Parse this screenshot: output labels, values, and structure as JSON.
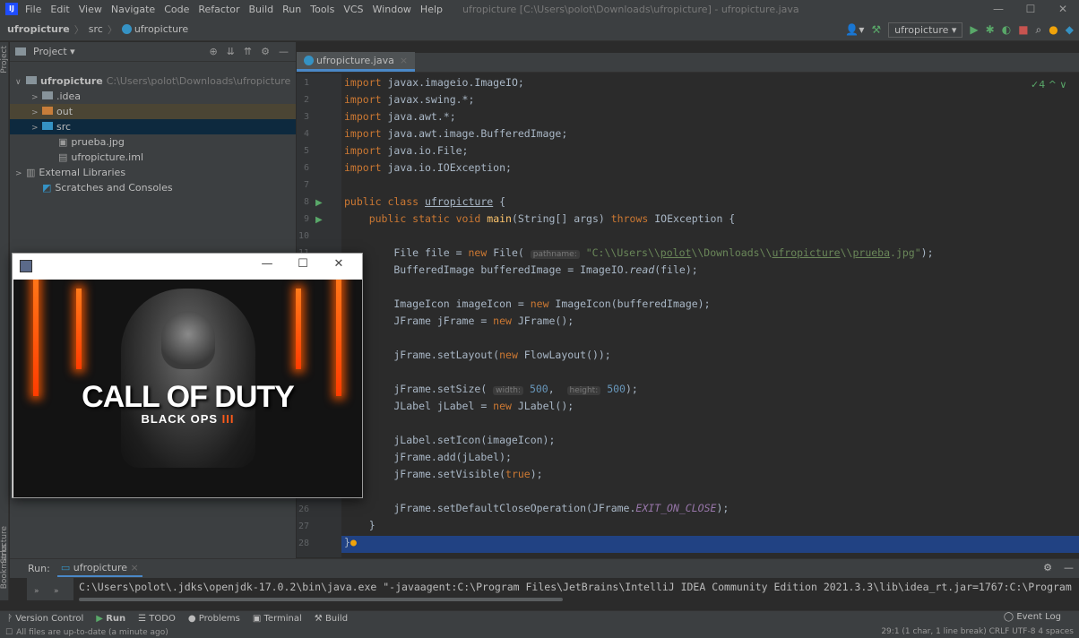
{
  "menubar": {
    "items": [
      "File",
      "Edit",
      "View",
      "Navigate",
      "Code",
      "Refactor",
      "Build",
      "Run",
      "Tools",
      "VCS",
      "Window",
      "Help"
    ],
    "window_title": "ufropicture [C:\\Users\\polot\\Downloads\\ufropicture] - ufropicture.java",
    "logo_text": "IJ",
    "win_min": "—",
    "win_max": "☐",
    "win_close": "✕"
  },
  "navbar": {
    "crumbs": [
      "ufropicture",
      "src",
      "ufropicture"
    ],
    "run_config": "ufropicture ▾"
  },
  "left_stripe": {
    "project": "Project",
    "structure": "Structure",
    "bookmarks": "Bookmarks"
  },
  "project_pane": {
    "title": "Project ▾",
    "tree": [
      {
        "arrow": "∨",
        "label": "ufropicture",
        "path": "C:\\Users\\polot\\Downloads\\ufropicture"
      },
      {
        "arrow": ">",
        "label": ".idea"
      },
      {
        "arrow": ">",
        "label": "out"
      },
      {
        "arrow": ">",
        "label": "src"
      },
      {
        "label": "prueba.jpg"
      },
      {
        "label": "ufropicture.iml"
      },
      {
        "arrow": ">",
        "label": "External Libraries"
      },
      {
        "label": "Scratches and Consoles"
      }
    ]
  },
  "editor": {
    "tab": "ufropicture.java",
    "tab_close": "×",
    "badge": "✓4 ^ ∨",
    "line_numbers": [
      "1",
      "2",
      "3",
      "4",
      "5",
      "6",
      "7",
      "8",
      "9",
      "10",
      "11",
      "26",
      "27",
      "28"
    ],
    "hints": {
      "pathname": "pathname:",
      "width": "width:",
      "height": "height:"
    }
  },
  "java_window": {
    "title_buttons": [
      "—",
      "☐",
      "✕"
    ],
    "image_title": "CALL OF DUTY",
    "image_subtitle": "BLACK OPS",
    "image_subtitle_num": "III"
  },
  "run_window": {
    "label": "Run:",
    "tab": "ufropicture",
    "tab_close": "×",
    "output": "C:\\Users\\polot\\.jdks\\openjdk-17.0.2\\bin\\java.exe \"-javaagent:C:\\Program Files\\JetBrains\\IntelliJ IDEA Community Edition 2021.3.3\\lib\\idea_rt.jar=1767:C:\\Program"
  },
  "bottom_bar": {
    "tabs": [
      "Version Control",
      "Run",
      "TODO",
      "Problems",
      "Terminal",
      "Build"
    ],
    "event_log": "Event Log"
  },
  "status_bar": {
    "message": "All files are up-to-date (a minute ago)",
    "right": "29:1 (1 char, 1 line break)  CRLF  UTF-8  4 spaces"
  },
  "colors": {
    "accent": "#4a88c7",
    "keyword": "#cc7832",
    "string": "#6a8759",
    "number": "#6897bb",
    "selection": "#214283"
  }
}
